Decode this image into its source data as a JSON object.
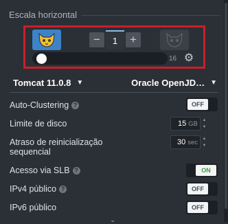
{
  "section": {
    "title": "Escala horizontal"
  },
  "scaling": {
    "node_count": "1",
    "decrement_label": "−",
    "increment_label": "+",
    "slider_max": "16",
    "slider_fraction": 0.0
  },
  "selectors": {
    "server": "Tomcat 11.0.8",
    "java": "Oracle OpenJD…"
  },
  "settings": {
    "auto_clustering": {
      "label": "Auto-Clustering",
      "toggle": "OFF"
    },
    "disk_limit": {
      "label": "Limite de disco",
      "value": "15",
      "unit": "GB"
    },
    "restart_delay": {
      "label_line1": "Atraso de reinicialização",
      "label_line2": "sequencial",
      "value": "30",
      "unit": "sec"
    },
    "slb_access": {
      "label": "Acesso via SLB",
      "toggle": "ON"
    },
    "ipv4": {
      "label": "IPv4 público",
      "toggle": "OFF"
    },
    "ipv6": {
      "label": "IPv6 público",
      "toggle": "OFF"
    }
  },
  "icons": {
    "help": "?",
    "gear": "⚙",
    "caret": "▼",
    "spin_up": "▲",
    "spin_down": "▼",
    "chevron": "⌄"
  },
  "colors": {
    "background": "#2b3036",
    "highlight_border": "#cc1e2a",
    "active_tile": "#3d83c9",
    "on_text": "#3a9b3a"
  }
}
